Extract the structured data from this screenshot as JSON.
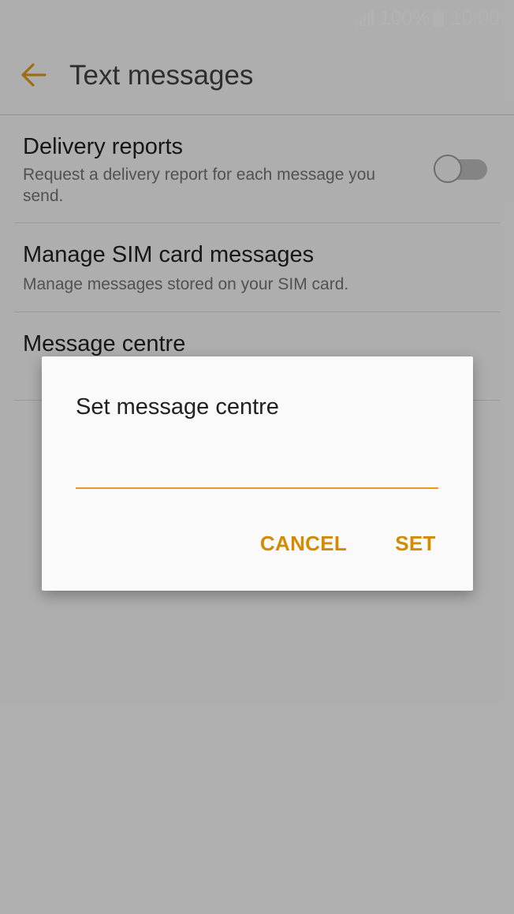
{
  "status_bar": {
    "battery_percent": "100%",
    "time": "10:00",
    "icons": [
      "signal-icon",
      "battery-icon"
    ]
  },
  "app_bar": {
    "title": "Text messages",
    "back_icon": "arrow-left-icon"
  },
  "settings": [
    {
      "title": "Delivery reports",
      "summary": "Request a delivery report for each message you send.",
      "toggle_on": false
    },
    {
      "title": "Manage SIM card messages",
      "summary": "Manage messages stored on your SIM card."
    },
    {
      "title": "Message centre"
    }
  ],
  "dialog": {
    "title": "Set message centre",
    "input_value": "",
    "cancel_label": "CANCEL",
    "set_label": "SET"
  },
  "colors": {
    "accent": "#d38b00",
    "input_underline": "#e09c1a",
    "scrim": "rgba(0,0,0,0.30)"
  }
}
